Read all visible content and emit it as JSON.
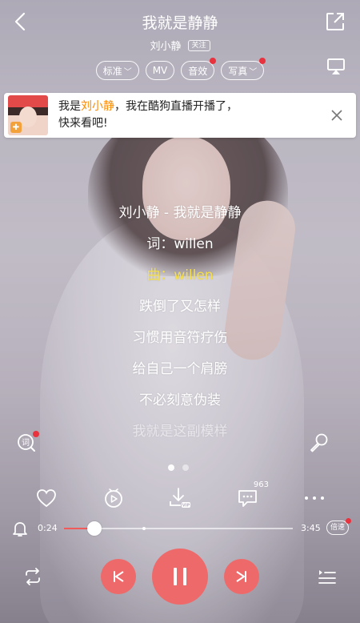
{
  "header": {
    "title": "我就是静静",
    "artist": "刘小静",
    "follow_label": "关注",
    "tags": [
      {
        "label": "标准",
        "has_chevron": true,
        "dot": false
      },
      {
        "label": "MV",
        "has_chevron": false,
        "dot": false
      },
      {
        "label": "音效",
        "has_chevron": false,
        "dot": true
      },
      {
        "label": "写真",
        "has_chevron": true,
        "dot": true
      }
    ]
  },
  "notice": {
    "prefix": "我是",
    "highlight": "刘小静",
    "suffix": "，我在酷狗直播开播了，",
    "line2": "快来看吧!"
  },
  "lyrics": [
    {
      "text": "刘小静 - 我就是静静",
      "state": "normal"
    },
    {
      "text": "词：willen",
      "state": "normal"
    },
    {
      "text": "曲：willen",
      "state": "active"
    },
    {
      "text": "跌倒了又怎样",
      "state": "normal"
    },
    {
      "text": "习惯用音符疗伤",
      "state": "normal"
    },
    {
      "text": "给自己一个肩膀",
      "state": "normal"
    },
    {
      "text": "不必刻意伪装",
      "state": "normal"
    },
    {
      "text": "我就是这副模样",
      "state": "normal"
    }
  ],
  "actions": {
    "comment_count": "963"
  },
  "player": {
    "current_time": "0:24",
    "total_time": "3:45",
    "progress_fraction": 0.133,
    "speed_label": "倍速"
  },
  "colors": {
    "accent": "#ee6a6a",
    "active_lyric": "#f5e04a",
    "notice_highlight": "#ff8a00",
    "badge_dot": "#e8333f"
  }
}
